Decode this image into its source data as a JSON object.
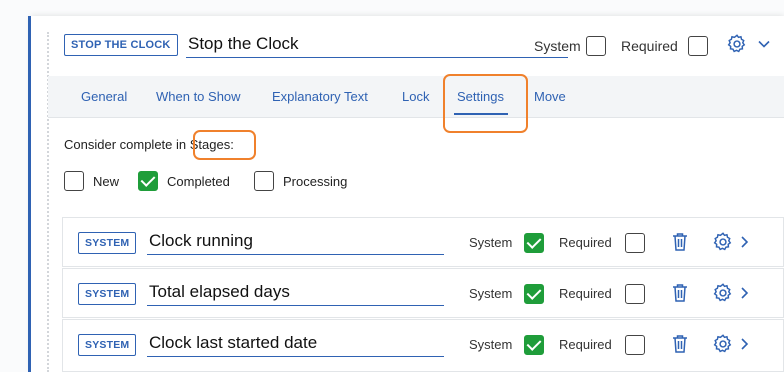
{
  "header": {
    "tag": "STOP THE CLOCK",
    "title_value": "Stop the Clock",
    "system_label": "System",
    "system_checked": false,
    "required_label": "Required",
    "required_checked": false,
    "gear_icon": "gear-icon",
    "chevron_icon": "chevron-down-icon"
  },
  "tabs": [
    {
      "label": "General",
      "active": false
    },
    {
      "label": "When to Show",
      "active": false
    },
    {
      "label": "Explanatory Text",
      "active": false
    },
    {
      "label": "Lock",
      "active": false
    },
    {
      "label": "Settings",
      "active": true
    },
    {
      "label": "Move",
      "active": false
    }
  ],
  "settings": {
    "complete_prefix": "Consider complete in",
    "stages_label": "Stages:",
    "stages": [
      {
        "label": "New",
        "checked": false
      },
      {
        "label": "Completed",
        "checked": true
      },
      {
        "label": "Processing",
        "checked": false
      }
    ]
  },
  "fields": [
    {
      "tag": "SYSTEM",
      "value": "Clock running",
      "system_label": "System",
      "system_checked": true,
      "required_label": "Required",
      "required_checked": false
    },
    {
      "tag": "SYSTEM",
      "value": "Total elapsed days",
      "system_label": "System",
      "system_checked": true,
      "required_label": "Required",
      "required_checked": false
    },
    {
      "tag": "SYSTEM",
      "value": "Clock last started date",
      "system_label": "System",
      "system_checked": true,
      "required_label": "Required",
      "required_checked": false
    }
  ],
  "colors": {
    "accent": "#2f62b3",
    "checked_green": "#1f9d3a",
    "highlight_orange": "#f0812c"
  }
}
